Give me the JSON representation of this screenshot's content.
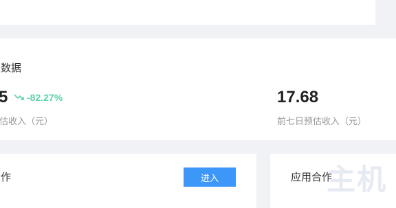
{
  "summary": {
    "title": "总数据",
    "metric_left": {
      "value": "5",
      "trend_text": "-82.27%",
      "trend_icon": "trend-down-icon",
      "label": "预估收入（元）"
    },
    "metric_right": {
      "value": "17.68",
      "label": "前七日预估收入（元）"
    }
  },
  "cooperation": {
    "title": "合作",
    "enter_label": "进入"
  },
  "app_cooperation": {
    "title": "应用合作",
    "watermark": "主机"
  },
  "colors": {
    "background": "#f1f2f6",
    "card": "#ffffff",
    "trend": "#5fd0a6",
    "button": "#3d97f9"
  }
}
